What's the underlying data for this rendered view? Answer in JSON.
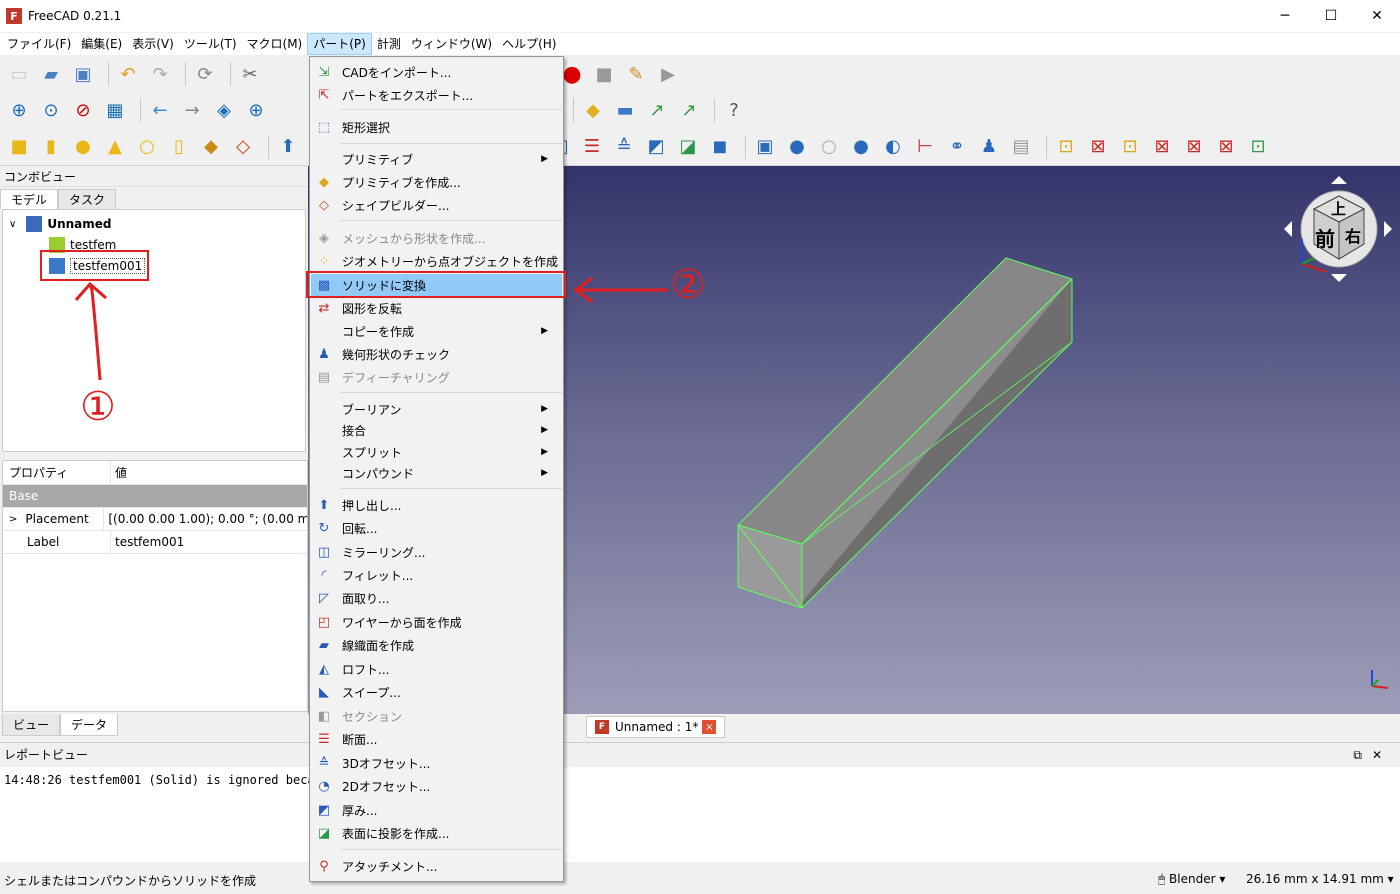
{
  "window": {
    "title": "FreeCAD 0.21.1"
  },
  "menubar": [
    "ファイル(F)",
    "編集(E)",
    "表示(V)",
    "ツール(T)",
    "マクロ(M)",
    "パート(P)",
    "計測",
    "ウィンドウ(W)",
    "ヘルプ(H)"
  ],
  "combo": {
    "title": "コンボビュー",
    "tabs": [
      "モデル",
      "タスク"
    ],
    "tree": {
      "root": "Unnamed",
      "child1": "testfem",
      "child2": "testfem001"
    },
    "props_header": {
      "property": "プロパティ",
      "value": "値"
    },
    "group": "Base",
    "rows": [
      {
        "name": "Placement",
        "value": "[(0.00 0.00 1.00); 0.00 °; (0.00 mm"
      },
      {
        "name": "Label",
        "value": "testfem001"
      }
    ],
    "bottom_tabs": [
      "ビュー",
      "データ"
    ]
  },
  "menu": {
    "items": [
      "CADをインポート...",
      "パートをエクスポート...",
      "矩形選択",
      "プリミティブ",
      "プリミティブを作成...",
      "シェイプビルダー...",
      "メッシュから形状を作成...",
      "ジオメトリーから点オブジェクトを作成",
      "ソリッドに変換",
      "図形を反転",
      "コピーを作成",
      "幾何形状のチェック",
      "デフィーチャリング",
      "ブーリアン",
      "接合",
      "スプリット",
      "コンパウンド",
      "押し出し...",
      "回転...",
      "ミラーリング...",
      "フィレット...",
      "面取り...",
      "ワイヤーから面を作成",
      "線織面を作成",
      "ロフト...",
      "スイープ...",
      "セクション",
      "断面...",
      "3Dオフセット...",
      "2Dオフセット...",
      "厚み...",
      "表面に投影を作成...",
      "アタッチメント..."
    ]
  },
  "viewport": {
    "doc_tab": "Unnamed : 1*"
  },
  "navcube": {
    "top": "上",
    "front": "前",
    "right": "右"
  },
  "report": {
    "title": "レポートビュー",
    "log": "14:48:26  testfem001 (Solid) is ignored beca"
  },
  "status": {
    "message": "シェルまたはコンパウンドからソリッドを作成",
    "nav_style": "Blender",
    "dimensions": "26.16 mm x 14.91 mm"
  },
  "annotations": {
    "label1": "①",
    "label2": "②"
  }
}
